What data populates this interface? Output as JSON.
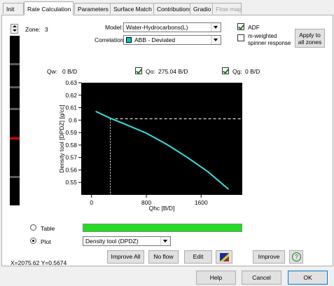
{
  "tabs": [
    {
      "label": "Init",
      "active": false,
      "disabled": false
    },
    {
      "label": "Rate Calculation",
      "active": true,
      "disabled": false
    },
    {
      "label": "Parameters",
      "active": false,
      "disabled": false
    },
    {
      "label": "Surface Match",
      "active": false,
      "disabled": false
    },
    {
      "label": "Contributions",
      "active": false,
      "disabled": false
    },
    {
      "label": "Gradio",
      "active": false,
      "disabled": false
    },
    {
      "label": "Flow map",
      "active": false,
      "disabled": true
    }
  ],
  "zone": {
    "label": "Zone:",
    "value": "3"
  },
  "model": {
    "label": "Model:",
    "value": "Water-Hydrocarbons(L)"
  },
  "correlation": {
    "label": "Correlation",
    "value": "ABB - Deviated",
    "swatch_color": "#00c8c8"
  },
  "adf": {
    "label": "ADF",
    "checked": true
  },
  "mweighted": {
    "label_line1": "m-weighted",
    "label_line2": "spinner response",
    "checked": false
  },
  "apply_button": {
    "line1": "Apply to",
    "line2": "all zones"
  },
  "rates": {
    "qw": {
      "label": "Qw:",
      "value": "0 B/D",
      "checked": false
    },
    "qo": {
      "label": "Qo:",
      "value": "275.04 B/D",
      "checked": true
    },
    "qg": {
      "label": "Qg:",
      "value": "0 B/D",
      "checked": true
    }
  },
  "chart_data": {
    "type": "line",
    "xlabel": "Qhc  [B/D]",
    "ylabel": "Density tool [DPDZ]  [g/cc]",
    "xlim": [
      -150,
      2200
    ],
    "ylim": [
      0.54,
      0.63
    ],
    "x_ticks": [
      "0",
      "800",
      "1600"
    ],
    "x_tick_values": [
      0,
      800,
      1600
    ],
    "y_ticks": [
      "0.63",
      "0.62",
      "0.61",
      "0.6",
      "0.59",
      "0.58",
      "0.57",
      "0.56",
      "0.55"
    ],
    "y_tick_values": [
      0.63,
      0.62,
      0.61,
      0.6,
      0.59,
      0.58,
      0.57,
      0.56,
      0.55
    ],
    "series": [
      {
        "color": "#33e0e0",
        "x": [
          60,
          275,
          500,
          800,
          1100,
          1400,
          1700,
          2000
        ],
        "y": [
          0.607,
          0.6015,
          0.5965,
          0.5895,
          0.5805,
          0.57,
          0.5585,
          0.5445
        ]
      }
    ],
    "reference_y": 0.601,
    "reference_x": 275,
    "background": "#000000",
    "grid": false
  },
  "display": {
    "table_label": "Table",
    "plot_label": "Plot",
    "selected": "plot",
    "progress_fraction": 1.0,
    "progress_color": "#22dd22",
    "plot_select": "Density tool (DPDZ)"
  },
  "buttons": {
    "improve_all": "Improve All",
    "no_flow": "No flow",
    "edit": "Edit",
    "improve": "Improve",
    "help_glyph": "?"
  },
  "cursor_readout": "X=2075.62 Y=0.5674",
  "footer": {
    "help": "Help",
    "cancel": "Cancel",
    "ok": "OK"
  }
}
